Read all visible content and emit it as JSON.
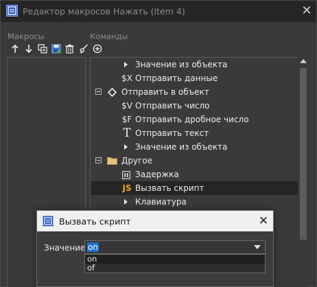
{
  "window": {
    "title": "Редактор макросов Нажать (Item 4)"
  },
  "panels": {
    "macros_label": "Макросы",
    "commands_label": "Команды"
  },
  "macro_toolbar": [
    {
      "name": "move-up-icon"
    },
    {
      "name": "move-down-icon"
    },
    {
      "name": "copy-icon"
    },
    {
      "name": "save-icon"
    },
    {
      "name": "delete-icon"
    },
    {
      "name": "clear-icon"
    }
  ],
  "commands_toolbar": [
    {
      "name": "add-icon"
    }
  ],
  "tree": {
    "items": [
      {
        "label": "Значение из объекта",
        "icon": "caret-right-icon"
      },
      {
        "label": "Отправить данные",
        "icon_text": "$X"
      },
      {
        "label": "Отправить в объект",
        "icon": "diamond-icon"
      },
      {
        "label": "Отправить число",
        "icon_text": "$V"
      },
      {
        "label": "Отправить дробное число",
        "icon_text": "$F"
      },
      {
        "label": "Отправить текст",
        "icon_text": "T"
      },
      {
        "label": "Значение из объекта",
        "icon": "caret-right-icon"
      },
      {
        "label": "Другое",
        "icon": "folder-icon"
      },
      {
        "label": "Задержка",
        "icon": "pause-icon"
      },
      {
        "label": "Вызвать скрипт",
        "icon_text": "JS"
      },
      {
        "label": "Клавиатура",
        "icon": "caret-right-icon"
      }
    ],
    "selected": "Вызвать скрипт"
  },
  "dialog": {
    "title": "Вызвать скрипт",
    "field_label": "Значение:",
    "combo_value": "on",
    "options": [
      "on",
      "of"
    ]
  },
  "colors": {
    "selection": "#1c6fd1",
    "js_icon": "#f0a020",
    "folder": "#e7c27a"
  }
}
